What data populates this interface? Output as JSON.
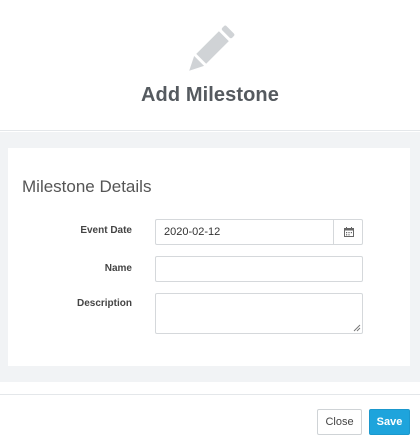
{
  "header": {
    "icon": "pencil-icon",
    "title": "Add Milestone"
  },
  "panel": {
    "title": "Milestone Details",
    "fields": {
      "event_date": {
        "label": "Event Date",
        "value": "2020-02-12",
        "icon": "calendar-icon"
      },
      "name": {
        "label": "Name",
        "value": ""
      },
      "description": {
        "label": "Description",
        "value": ""
      }
    }
  },
  "footer": {
    "close_label": "Close",
    "save_label": "Save"
  },
  "colors": {
    "accent": "#1ea4dc",
    "icon_gray": "#d0d3d6",
    "body_bg": "#f1f3f5"
  }
}
